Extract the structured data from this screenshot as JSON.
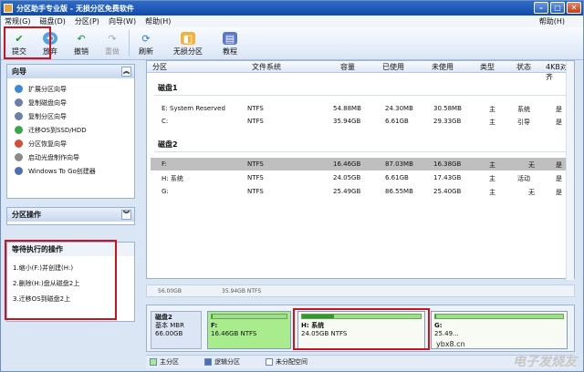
{
  "window": {
    "title": "分区助手专业版 - 无损分区免费软件"
  },
  "menu": {
    "items": [
      "常规(G)",
      "磁盘(D)",
      "分区(P)",
      "向导(W)",
      "帮助(H)"
    ],
    "right": "帮助(H)"
  },
  "toolbar": {
    "commit": "提交",
    "discard": "放弃",
    "undo": "撤销",
    "redo": "重做",
    "refresh": "刷新",
    "lossless": "无损分区",
    "tutorial": "教程"
  },
  "wizard": {
    "title": "向导",
    "items": [
      "扩展分区向导",
      "复制磁盘向导",
      "复制分区向导",
      "迁移OS到SSD/HDD",
      "分区恢复向导",
      "启动光盘制作向导",
      "Windows To Go创建器"
    ]
  },
  "partition_ops": {
    "title": "分区操作"
  },
  "pending": {
    "title": "等待执行的操作",
    "items": [
      "1.缩小(F:)并创建(H:)",
      "2.删除(H:)盘从磁盘2上",
      "3.迁移OS到磁盘2上"
    ]
  },
  "columns": [
    "分区",
    "文件系统",
    "容量",
    "已使用",
    "未使用",
    "类型",
    "状态",
    "4KB对齐"
  ],
  "disks": [
    {
      "label": "磁盘1",
      "rows": [
        {
          "name": "E: System Reserved",
          "fs": "NTFS",
          "cap": "54.88MB",
          "used": "24.30MB",
          "free": "30.58MB",
          "type": "主",
          "status": "系统",
          "align": "是"
        },
        {
          "name": "C:",
          "fs": "NTFS",
          "cap": "35.94GB",
          "used": "6.61GB",
          "free": "29.33GB",
          "type": "主",
          "status": "引导",
          "align": "是"
        }
      ]
    },
    {
      "label": "磁盘2",
      "rows": [
        {
          "name": "F:",
          "fs": "NTFS",
          "cap": "16.46GB",
          "used": "87.03MB",
          "free": "16.38GB",
          "type": "主",
          "status": "无",
          "align": "是"
        },
        {
          "name": "H: 系统",
          "fs": "NTFS",
          "cap": "24.05GB",
          "used": "6.61GB",
          "free": "17.43GB",
          "type": "主",
          "status": "活动",
          "align": "是"
        },
        {
          "name": "G:",
          "fs": "NTFS",
          "cap": "25.49GB",
          "used": "86.55MB",
          "free": "25.40GB",
          "type": "主",
          "status": "无",
          "align": "是"
        }
      ]
    }
  ],
  "strip": {
    "left": "56.00GB",
    "mid": "35.94GB NTFS"
  },
  "diskmap": {
    "name": "磁盘2",
    "kind": "基本 MBR",
    "size": "66.00GB",
    "parts": [
      {
        "label": "F:",
        "info": "16.46GB NTFS",
        "fill": 0.01
      },
      {
        "label": "H: 系统",
        "info": "24.05GB NTFS",
        "fill": 0.27
      },
      {
        "label": "G:",
        "info": "25.49...",
        "fill": 0.01
      }
    ]
  },
  "legend": {
    "primary": "主分区",
    "logical": "逻辑分区",
    "unalloc": "未分配空间"
  },
  "watermark": {
    "url": "ybx8.cn",
    "brand": "电子发烧友"
  }
}
